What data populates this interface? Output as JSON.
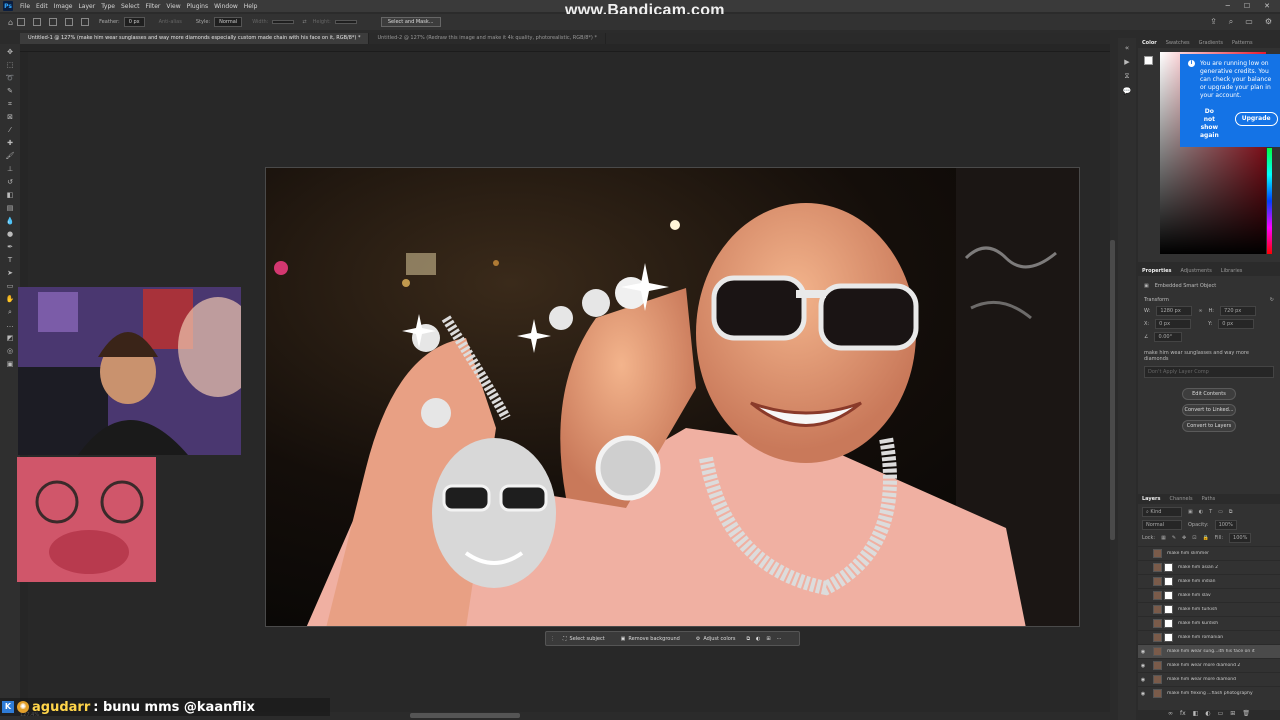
{
  "app": {
    "menu": [
      "File",
      "Edit",
      "Image",
      "Layer",
      "Type",
      "Select",
      "Filter",
      "View",
      "Plugins",
      "Window",
      "Help"
    ],
    "watermark": "www.Bandicam.com"
  },
  "options_bar": {
    "feather_label": "Feather:",
    "feather_value": "0 px",
    "antialias_label": "Anti-alias",
    "style_label": "Style:",
    "style_value": "Normal",
    "width_label": "Width:",
    "height_label": "Height:",
    "select_mask_button": "Select and Mask..."
  },
  "tabs": [
    {
      "label": "Untitled-1 @ 127% (make him wear sunglasses and way more diamonds especially custom made chain with his face on it, RGB/8*) *",
      "active": true
    },
    {
      "label": "Untitled-2 @ 127% (Redraw this image and make it 4k quality, photorealistic, RGB/8*) *",
      "active": false
    }
  ],
  "context_bar": {
    "select_subject": "Select subject",
    "remove_background": "Remove background",
    "adjust_colors": "Adjust colors"
  },
  "color_panel": {
    "tabs": [
      "Color",
      "Swatches",
      "Gradients",
      "Patterns"
    ],
    "foreground": "#ffffff",
    "background": "#000000"
  },
  "credits_popup": {
    "message": "You are running low on generative credits. You can check your balance or upgrade your plan in your account.",
    "dismiss": "Do not show again",
    "upgrade": "Upgrade"
  },
  "properties": {
    "tabs": [
      "Properties",
      "Adjustments",
      "Libraries"
    ],
    "type": "Embedded Smart Object",
    "section": "Transform",
    "w_label": "W:",
    "w_value": "1280 px",
    "h_label": "H:",
    "h_value": "720 px",
    "x_label": "X:",
    "x_value": "0 px",
    "y_label": "Y:",
    "y_value": "0 px",
    "angle_value": "0.00°",
    "prompt": "make him wear sunglasses and way more diamonds",
    "layer_comp": "Don't Apply Layer Comp",
    "edit_contents": "Edit Contents",
    "convert_linked": "Convert to Linked...",
    "convert_layers": "Convert to Layers"
  },
  "layers": {
    "tabs": [
      "Layers",
      "Channels",
      "Paths"
    ],
    "filter_kind": "Kind",
    "blend_mode": "Normal",
    "opacity_label": "Opacity:",
    "opacity_value": "100%",
    "lock_label": "Lock:",
    "fill_label": "Fill:",
    "fill_value": "100%",
    "items": [
      {
        "name": "make him slimmer",
        "visible": false,
        "selected": false
      },
      {
        "name": "make him asian 2",
        "visible": false,
        "selected": false
      },
      {
        "name": "make him indian",
        "visible": false,
        "selected": false
      },
      {
        "name": "make him slav",
        "visible": false,
        "selected": false
      },
      {
        "name": "make him turkish",
        "visible": false,
        "selected": false
      },
      {
        "name": "make him kurdish",
        "visible": false,
        "selected": false
      },
      {
        "name": "make him romanian",
        "visible": false,
        "selected": false
      },
      {
        "name": "make him wear sung...ith his face on it",
        "visible": true,
        "selected": true
      },
      {
        "name": "make him wear more diamond 2",
        "visible": true,
        "selected": false
      },
      {
        "name": "make him wear more diamond",
        "visible": true,
        "selected": false
      },
      {
        "name": "make him flexing ...flash photography",
        "visible": true,
        "selected": false
      }
    ]
  },
  "chat": {
    "user": "agudarr",
    "message": ": bunu mms @kaanflix"
  },
  "status": {
    "zoom": "127.4%"
  }
}
